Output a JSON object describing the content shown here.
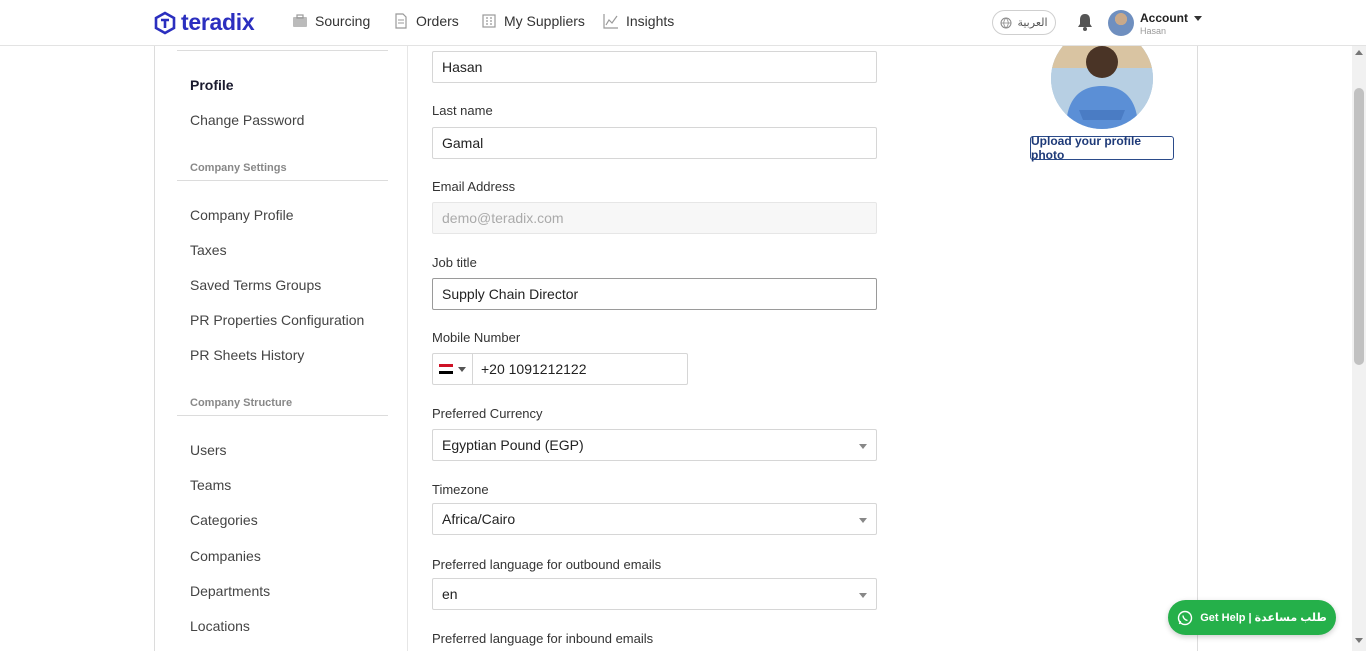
{
  "brand": {
    "name": "teradix",
    "color": "#2b2fbf"
  },
  "nav": {
    "items": [
      {
        "label": "Sourcing",
        "icon": "briefcase-icon"
      },
      {
        "label": "Orders",
        "icon": "document-icon"
      },
      {
        "label": "My Suppliers",
        "icon": "building-icon"
      },
      {
        "label": "Insights",
        "icon": "chart-line-icon"
      }
    ],
    "language_toggle": "العربية",
    "account_label": "Account",
    "account_user": "Hasan"
  },
  "sidebar": {
    "items_top": [
      "Profile",
      "Change Password"
    ],
    "section_company_settings": "Company Settings",
    "items_company_settings": [
      "Company Profile",
      "Taxes",
      "Saved Terms Groups",
      "PR Properties Configuration",
      "PR Sheets History"
    ],
    "section_company_structure": "Company Structure",
    "items_company_structure": [
      "Users",
      "Teams",
      "Categories",
      "Companies",
      "Departments",
      "Locations"
    ]
  },
  "form": {
    "first_name_value": "Hasan",
    "last_name_label": "Last name",
    "last_name_value": "Gamal",
    "email_label": "Email Address",
    "email_placeholder": "demo@teradix.com",
    "job_title_label": "Job title",
    "job_title_value": "Supply Chain Director",
    "mobile_label": "Mobile Number",
    "mobile_value": "+20 1091212122",
    "currency_label": "Preferred Currency",
    "currency_value": "Egyptian Pound (EGP)",
    "timezone_label": "Timezone",
    "timezone_value": "Africa/Cairo",
    "outbound_lang_label": "Preferred language for outbound emails",
    "outbound_lang_value": "en",
    "inbound_lang_label": "Preferred language for inbound emails"
  },
  "profile_photo": {
    "upload_label": "Upload your profile photo"
  },
  "help": {
    "label": "Get Help | طلب مساعدة",
    "color": "#25b04a"
  }
}
